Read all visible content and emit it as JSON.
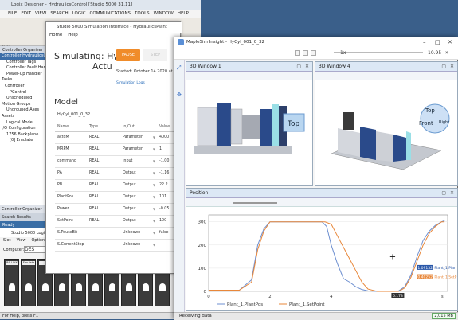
{
  "logix": {
    "title": "Logix Designer - HydraulicsControl [Studio 5000 31.11]",
    "menu": [
      "FILE",
      "EDIT",
      "VIEW",
      "SEARCH",
      "LOGIC",
      "COMMUNICATIONS",
      "TOOLS",
      "WINDOW",
      "HELP"
    ],
    "status_list": [
      "RUN",
      "OK",
      "BAT",
      "I/O"
    ],
    "controller_organizer": "Controller Organizer",
    "tree": [
      "Controller HydraulicsControl",
      "Controller Tags",
      "Controller Fault Handler",
      "Power-Up Handler",
      "Tasks",
      "Controller",
      "PControl",
      "Unscheduled",
      "Motion Groups",
      "Ungrouped Axes",
      "Assets",
      "Logical Model",
      "I/O Configuration",
      "1756 Backplane",
      "[0] Emulate"
    ],
    "tab_controller_organizer": "Controller Organizer",
    "tab_search_results": "Search Results",
    "ready": "Ready",
    "status": "For Help, press F1"
  },
  "emulate": {
    "title": "Studio 5000 Logix Emulate",
    "menu": [
      "Slot",
      "View",
      "Options"
    ],
    "computer_label": "Computer:",
    "computer_value": "DES",
    "slots": [
      "RS LINX",
      "Emulate",
      "",
      "",
      "",
      "",
      "",
      "",
      "",
      ""
    ]
  },
  "studio": {
    "title": "Studio 5000 Simulation Interface - HydraulicsPlant",
    "menu": [
      "Home",
      "Help"
    ],
    "simulating": "Simulating:",
    "model_short": "Hyd",
    "model_short2": "Actu",
    "pause": "PAUSE",
    "step": "STEP",
    "started": "Started: October 14 2020 at",
    "sim_logs": "Simulation Logs",
    "model_heading": "Model",
    "model_name": "HyCyl_001_0_32",
    "columns": [
      "Name",
      "Type",
      "In/Out",
      "Value"
    ],
    "rows": [
      {
        "name": "actdM",
        "type": "REAL",
        "io": "Parameter",
        "value": "4000"
      },
      {
        "name": "MRPM",
        "type": "REAL",
        "io": "Parameter",
        "value": "1"
      },
      {
        "name": "command",
        "type": "REAL",
        "io": "Input",
        "value": "-1.00"
      },
      {
        "name": "PA",
        "type": "REAL",
        "io": "Output",
        "value": "-1.16"
      },
      {
        "name": "PB",
        "type": "REAL",
        "io": "Output",
        "value": "22.2"
      },
      {
        "name": "PlantPos",
        "type": "REAL",
        "io": "Output",
        "value": "101"
      },
      {
        "name": "Power",
        "type": "REAL",
        "io": "Output",
        "value": "-0.05"
      },
      {
        "name": "SetPoint",
        "type": "REAL",
        "io": "Output",
        "value": "100"
      },
      {
        "name": "S.PauseBit",
        "type": "",
        "io": "Unknown",
        "value": "false"
      },
      {
        "name": "S.CurrentStep",
        "type": "",
        "io": "Unknown",
        "value": ""
      }
    ]
  },
  "maple": {
    "title": "MapleSim Insight - HyCyl_001_0_32",
    "speed": "1x",
    "time": "10.95",
    "win1": "3D Window 1",
    "win4": "3D Window 4",
    "top_label": "Top",
    "front_label": "Front",
    "right_label": "Right",
    "top_small": "Top",
    "position_title": "Position",
    "status": "Receiving data",
    "mem": "2,015 MB",
    "tooltip1": "1.09132",
    "tooltip1_label": "Plant_1.Plan",
    "tooltip2": "0.402525",
    "tooltip2_label": "Plant_1.SetP",
    "cursor_time": "6.173",
    "unit": "s"
  },
  "chart_data": {
    "type": "line",
    "title": "Position",
    "xlim": [
      0,
      7.8
    ],
    "ylim": [
      0,
      330
    ],
    "xticks": [
      0,
      2,
      4,
      6
    ],
    "yticks": [
      0,
      100,
      200,
      300
    ],
    "xlabel": "s",
    "legend_position": "bottom",
    "series": [
      {
        "name": "Plant_1.PlantPos",
        "color": "#6d8fd0",
        "x": [
          0,
          1.0,
          1.4,
          1.6,
          1.8,
          2.0,
          3.4,
          3.7,
          3.85,
          4.0,
          4.2,
          4.4,
          4.6,
          4.8,
          5.0,
          5.2,
          5.5,
          6.0,
          6.2,
          6.4,
          6.6,
          6.8,
          7.0,
          7.2,
          7.4,
          7.6,
          7.7
        ],
        "y": [
          5,
          5,
          50,
          200,
          270,
          300,
          300,
          300,
          280,
          200,
          120,
          55,
          40,
          20,
          8,
          2,
          0,
          0,
          2,
          20,
          70,
          150,
          220,
          260,
          285,
          300,
          305
        ]
      },
      {
        "name": "Plant_1.SetPoint",
        "color": "#e8873a",
        "x": [
          0,
          1.0,
          1.4,
          1.6,
          1.8,
          2.0,
          3.4,
          3.6,
          3.8,
          4.0,
          4.2,
          4.4,
          4.6,
          4.8,
          5.0,
          5.2,
          5.5,
          6.0,
          6.2,
          6.4,
          6.6,
          6.8,
          7.0,
          7.2,
          7.4,
          7.6,
          7.7
        ],
        "y": [
          5,
          5,
          40,
          180,
          260,
          300,
          300,
          300,
          300,
          290,
          240,
          190,
          140,
          90,
          40,
          10,
          0,
          0,
          0,
          15,
          60,
          130,
          200,
          250,
          280,
          300,
          300
        ]
      }
    ]
  }
}
